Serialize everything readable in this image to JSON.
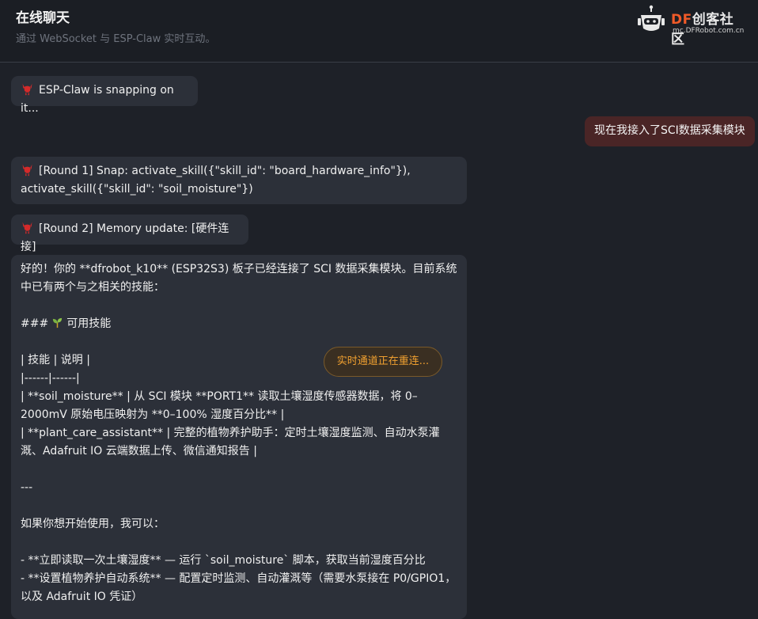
{
  "header": {
    "title": "在线聊天",
    "subtitle": "通过 WebSocket 与 ESP-Claw 实时互动。",
    "logo": {
      "brand_df": "DF",
      "brand_rest": "创客社区",
      "url": "mc.DFRobot.com.cn"
    }
  },
  "messages": {
    "status": "ESP-Claw is snapping on it...",
    "user": "现在我接入了SCI数据采集模块",
    "round1": "[Round 1] Snap: activate_skill({\"skill_id\": \"board_hardware_info\"}), activate_skill({\"skill_id\": \"soil_moisture\"})",
    "round2": "[Round 2] Memory update: [硬件连接]",
    "reply": {
      "l1": "好的！你的 **dfrobot_k10** (ESP32S3) 板子已经连接了 SCI 数据采集模块。目前系统中已有两个与之相关的技能：",
      "l2_prefix": "###",
      "l2_text": "可用技能",
      "l3": "| 技能 | 说明 |",
      "l4": "|------|------|",
      "l5": "| **soil_moisture** | 从 SCI 模块 **PORT1** 读取土壤湿度传感器数据，将 0–2000mV 原始电压映射为 **0–100% 湿度百分比** |",
      "l6": "| **plant_care_assistant** | 完整的植物养护助手：定时土壤湿度监测、自动水泵灌溉、Adafruit IO 云端数据上传、微信通知报告 |",
      "l7": "---",
      "l8": "如果你想开始使用，我可以：",
      "l9": "- **立即读取一次土壤湿度** — 运行 `soil_moisture` 脚本，获取当前湿度百分比",
      "l10": "- **设置植物养护自动系统** — 配置定时监测、自动灌溉等（需要水泵接在 P0/GPIO1，以及 Adafruit IO 凭证）"
    }
  },
  "toast": "实时通道正在重连...",
  "colors": {
    "accent": "#f05a28",
    "user_bubble": "#4a2526",
    "bot_bubble": "#2c3039",
    "toast_text": "#f0a030"
  },
  "icons": {
    "claw": "claw-icon",
    "sprout": "seedling-icon",
    "logo": "robot-logo-icon"
  }
}
